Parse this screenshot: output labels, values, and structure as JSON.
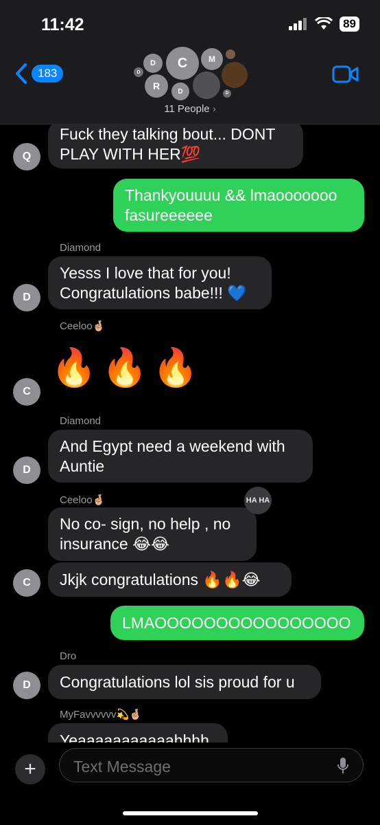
{
  "status": {
    "time": "11:42",
    "battery": "89"
  },
  "header": {
    "back_count": "183",
    "people_label": "11 People",
    "avatar_initials": [
      "D",
      "C",
      "M",
      "R",
      "D"
    ]
  },
  "messages": [
    {
      "type": "incoming",
      "initial": "Q",
      "lines": [
        "Fuck they talking bout... DONT",
        "PLAY WITH HER💯"
      ]
    },
    {
      "type": "outgoing",
      "lines": [
        "Thankyouuuu && lmaooooooo",
        "fasureeeeee"
      ]
    },
    {
      "type": "incoming",
      "sender": "Diamond",
      "initial": "D",
      "lines": [
        "Yesss I love that for you!",
        "Congratulations babe!!! 💙"
      ]
    },
    {
      "type": "incoming",
      "sender": "Ceeloo🤞🏼",
      "initial": "C",
      "emoji": [
        "🔥",
        "🔥",
        "🔥"
      ]
    },
    {
      "type": "incoming",
      "sender": "Diamond",
      "initial": "D",
      "lines": [
        "And Egypt need a weekend with",
        "Auntie"
      ]
    },
    {
      "type": "incoming",
      "sender": "Ceeloo🤞🏼",
      "lines": [
        "No co- sign, no help , no",
        "insurance 😂😂"
      ],
      "tapback": "HA HA"
    },
    {
      "type": "incoming",
      "initial": "C",
      "lines": [
        "Jkjk congratulations 🔥🔥😂"
      ]
    },
    {
      "type": "outgoing",
      "lines": [
        "LMAOOOOOOOOOOOOOOOO"
      ]
    },
    {
      "type": "incoming",
      "sender": "Dro",
      "initial": "D",
      "lines": [
        "Congratulations lol sis proud for u"
      ]
    },
    {
      "type": "incoming",
      "sender": "MyFavvvvvv💫🤞🏼",
      "lines": [
        "Yeaaaaaaaaaaahhhh"
      ]
    }
  ],
  "input": {
    "placeholder": "Text Message"
  },
  "icons": {
    "back": "chevron-left-icon",
    "video": "video-camera-icon",
    "add": "plus-icon",
    "mic": "microphone-icon",
    "signal": "signal-icon",
    "wifi": "wifi-icon"
  },
  "colors": {
    "outgoing": "#30d158",
    "incoming": "#262628",
    "accent": "#0a84ff"
  }
}
